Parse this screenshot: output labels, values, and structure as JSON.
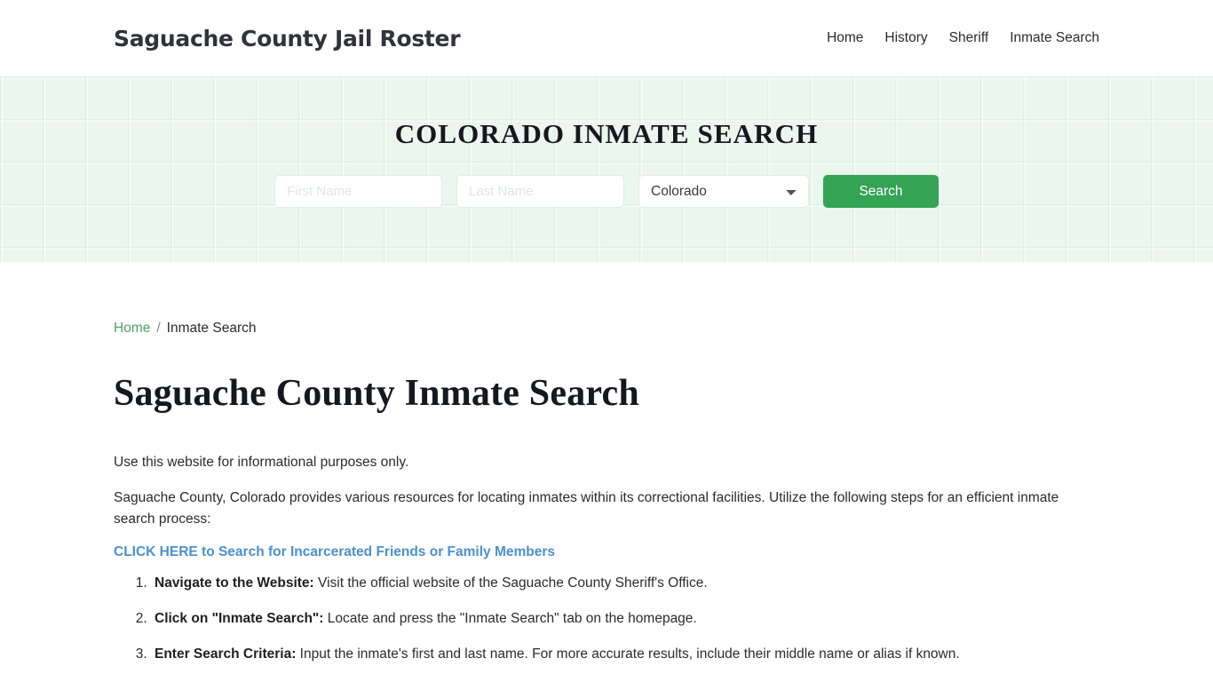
{
  "header": {
    "brand": "Saguache County Jail Roster",
    "nav": [
      {
        "label": "Home"
      },
      {
        "label": "History"
      },
      {
        "label": "Sheriff"
      },
      {
        "label": "Inmate Search"
      }
    ]
  },
  "hero": {
    "title": "COLORADO INMATE SEARCH",
    "first_name_placeholder": "First Name",
    "last_name_placeholder": "Last Name",
    "state_selected": "Colorado",
    "state_options": [
      "Colorado"
    ],
    "search_button": "Search",
    "accent_color": "#34a354",
    "background_color": "#eaf6ee"
  },
  "breadcrumb": {
    "home": "Home",
    "separator": "/",
    "current": "Inmate Search"
  },
  "main": {
    "page_title": "Saguache County Inmate Search",
    "paragraph_1": "Use this website for informational purposes only.",
    "paragraph_2": "Saguache County, Colorado provides various resources for locating inmates within its correctional facilities. Utilize the following steps for an efficient inmate search process:",
    "cta_link": "CLICK HERE to Search for Incarcerated Friends or Family Members",
    "cta_color": "#4a90d0",
    "steps": [
      {
        "lead": "Navigate to the Website:",
        "text": " Visit the official website of the Saguache County Sheriff's Office."
      },
      {
        "lead": "Click on \"Inmate Search\":",
        "text": " Locate and press the \"Inmate Search\" tab on the homepage."
      },
      {
        "lead": "Enter Search Criteria:",
        "text": " Input the inmate's first and last name. For more accurate results, include their middle name or alias if known."
      }
    ]
  }
}
